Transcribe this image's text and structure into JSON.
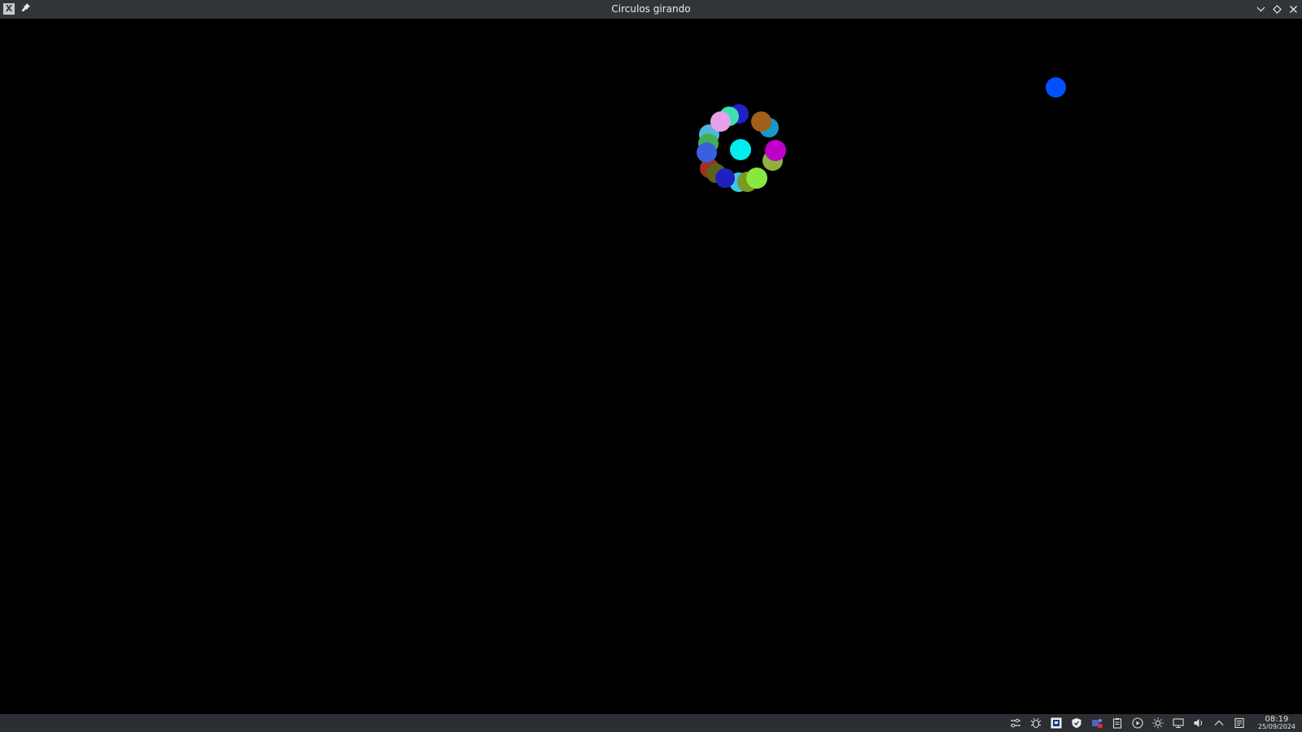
{
  "window": {
    "title": "Circulos girando",
    "app_icon_glyph": "X",
    "left_icons": [
      "x-app-icon",
      "pin-icon"
    ],
    "controls": [
      "minimize-icon",
      "maximize-icon",
      "close-icon"
    ]
  },
  "scene": {
    "background": "#000000",
    "center_dot_color": "#00eeee",
    "ring_dot_colors": [
      "#7ed6e4",
      "#2020c8",
      "#3fe0b0",
      "#e8a0e8",
      "#a0601a",
      "#1898c8",
      "#c000c8",
      "#90b040",
      "#88e840",
      "#7a9a20",
      "#38c8e8",
      "#2020c0",
      "#606018",
      "#a03020",
      "#3a60e0",
      "#40b050",
      "#50b8e0"
    ],
    "lone_dot_color": "#0050ff"
  },
  "taskbar": {
    "tray_icons": [
      "settings-sliders-icon",
      "bug-icon",
      "password-manager-icon",
      "shield-icon",
      "teams-icon",
      "clipboard-icon",
      "media-play-icon",
      "brightness-icon",
      "display-icon",
      "volume-icon",
      "chevron-up-icon",
      "notes-icon"
    ],
    "clock_time": "08:19",
    "clock_date": "25/09/2024"
  }
}
